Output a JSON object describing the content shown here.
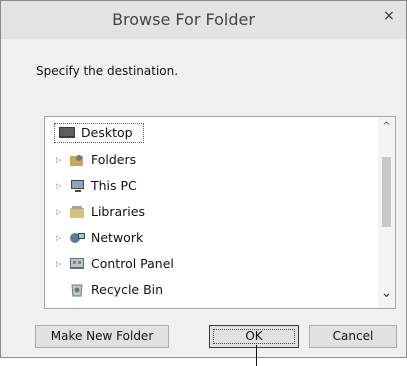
{
  "dialog": {
    "title": "Browse For Folder",
    "close_glyph": "×",
    "prompt": "Specify the destination."
  },
  "tree": {
    "items": [
      {
        "label": "Desktop",
        "icon": "desktop-icon",
        "has_expander": false,
        "selected": true
      },
      {
        "label": "Folders",
        "icon": "user-folder-icon",
        "has_expander": true
      },
      {
        "label": "This PC",
        "icon": "computer-icon",
        "has_expander": true
      },
      {
        "label": "Libraries",
        "icon": "libraries-icon",
        "has_expander": true
      },
      {
        "label": "Network",
        "icon": "network-icon",
        "has_expander": true
      },
      {
        "label": "Control Panel",
        "icon": "control-panel-icon",
        "has_expander": true
      },
      {
        "label": "Recycle Bin",
        "icon": "recycle-bin-icon",
        "has_expander": false
      }
    ],
    "expander_glyph": "▷",
    "scroll_up_glyph": "^",
    "scroll_down_glyph": "⌄"
  },
  "buttons": {
    "make_new_folder": "Make New Folder",
    "ok": "OK",
    "cancel": "Cancel"
  },
  "colors": {
    "titlebar": "#e3e3e3",
    "dialog_bg": "#f0f0f0",
    "tree_bg": "#ffffff"
  }
}
